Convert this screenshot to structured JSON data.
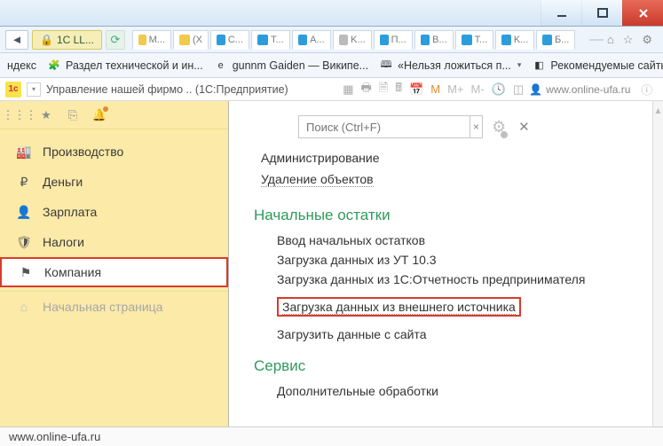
{
  "window": {
    "address_chip": "1C LL...",
    "tabs": [
      {
        "label": "M...",
        "iconClass": "yellow"
      },
      {
        "label": "(X",
        "iconClass": "yellow"
      },
      {
        "label": "C...",
        "iconClass": "blue"
      },
      {
        "label": "T...",
        "iconClass": "blue"
      },
      {
        "label": "A...",
        "iconClass": "blue"
      },
      {
        "label": "K...",
        "iconClass": "grey"
      },
      {
        "label": "П...",
        "iconClass": "blue"
      },
      {
        "label": "B...",
        "iconClass": "blue"
      },
      {
        "label": "T...",
        "iconClass": "blue"
      },
      {
        "label": "K...",
        "iconClass": "blue"
      },
      {
        "label": "Б...",
        "iconClass": "blue"
      }
    ]
  },
  "bookmarks": [
    {
      "label": "ндекс",
      "icon": "",
      "drop": false
    },
    {
      "label": "Раздел технической и ин...",
      "icon": "🧩",
      "drop": false
    },
    {
      "label": "gunnm Gaiden — Википе...",
      "icon": "e",
      "drop": false
    },
    {
      "label": "«Нельзя ложиться п...",
      "icon": "🕮",
      "drop": true
    },
    {
      "label": "Рекомендуемые сайты",
      "icon": "◧",
      "drop": true
    }
  ],
  "c1toolbar": {
    "title": "Управление нашей фирмо .. (1С:Предприятие)",
    "m_labels": [
      "M",
      "M+",
      "M-"
    ],
    "username": "www.online-ufa.ru"
  },
  "sidebar": {
    "items": [
      {
        "label": "Производство",
        "icon": "factory"
      },
      {
        "label": "Деньги",
        "icon": "ruble"
      },
      {
        "label": "Зарплата",
        "icon": "person"
      },
      {
        "label": "Налоги",
        "icon": "shield"
      },
      {
        "label": "Компания",
        "icon": "flag",
        "selected": true
      },
      {
        "label": "Начальная страница",
        "icon": "home",
        "muted": true
      }
    ]
  },
  "content": {
    "search_placeholder": "Поиск (Ctrl+F)",
    "top_links": [
      {
        "label": "Администрирование",
        "style": "plain"
      },
      {
        "label": "Удаление объектов",
        "style": "underdot"
      }
    ],
    "group1_h": "Начальные остатки",
    "group1_links": [
      {
        "label": "Ввод начальных остатков"
      },
      {
        "label": "Загрузка данных из УТ 10.3"
      },
      {
        "label": "Загрузка данных из 1С:Отчетность предпринимателя"
      },
      {
        "label": "Загрузка данных из внешнего источника",
        "boxed": true
      },
      {
        "label": "Загрузить данные с сайта"
      }
    ],
    "group2_h": "Сервис",
    "group2_links": [
      {
        "label": "Дополнительные обработки"
      }
    ]
  },
  "footer": {
    "text": "www.online-ufa.ru"
  }
}
